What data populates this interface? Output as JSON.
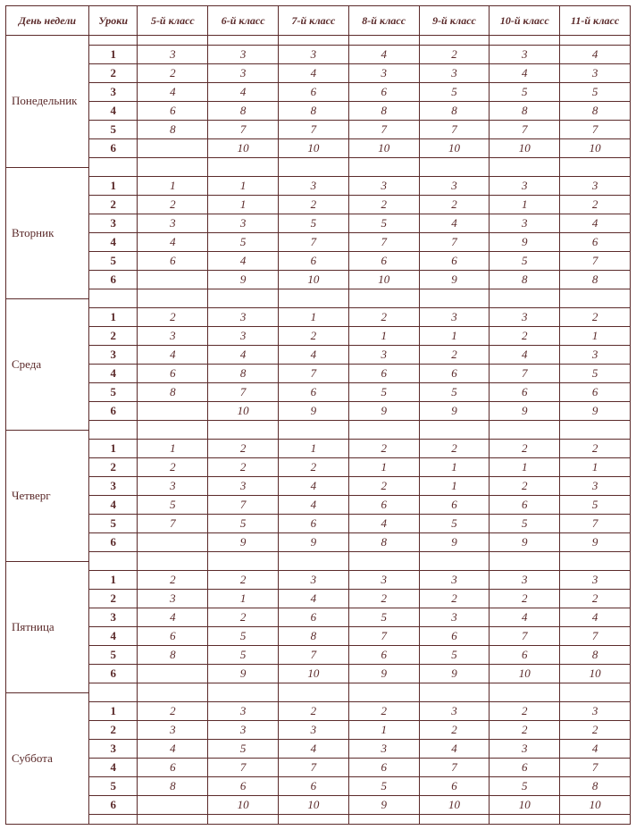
{
  "headers": {
    "day": "День недели",
    "lessons": "Уроки",
    "grades": [
      "5-й класс",
      "6-й класс",
      "7-й класс",
      "8-й класс",
      "9-й класс",
      "10-й класс",
      "11-й класс"
    ]
  },
  "lesson_labels": [
    "1",
    "2",
    "3",
    "4",
    "5",
    "6"
  ],
  "days": [
    {
      "name": "Понедельник",
      "rows": [
        [
          "3",
          "3",
          "3",
          "4",
          "2",
          "3",
          "4"
        ],
        [
          "2",
          "3",
          "4",
          "3",
          "3",
          "4",
          "3"
        ],
        [
          "4",
          "4",
          "6",
          "6",
          "5",
          "5",
          "5"
        ],
        [
          "6",
          "8",
          "8",
          "8",
          "8",
          "8",
          "8"
        ],
        [
          "8",
          "7",
          "7",
          "7",
          "7",
          "7",
          "7"
        ],
        [
          "",
          "10",
          "10",
          "10",
          "10",
          "10",
          "10"
        ]
      ]
    },
    {
      "name": "Вторник",
      "rows": [
        [
          "1",
          "1",
          "3",
          "3",
          "3",
          "3",
          "3"
        ],
        [
          "2",
          "1",
          "2",
          "2",
          "2",
          "1",
          "2"
        ],
        [
          "3",
          "3",
          "5",
          "5",
          "4",
          "3",
          "4"
        ],
        [
          "4",
          "5",
          "7",
          "7",
          "7",
          "9",
          "6"
        ],
        [
          "6",
          "4",
          "6",
          "6",
          "6",
          "5",
          "7"
        ],
        [
          "",
          "9",
          "10",
          "10",
          "9",
          "8",
          "8"
        ]
      ]
    },
    {
      "name": "Среда",
      "rows": [
        [
          "2",
          "3",
          "1",
          "2",
          "3",
          "3",
          "2"
        ],
        [
          "3",
          "3",
          "2",
          "1",
          "1",
          "2",
          "1"
        ],
        [
          "4",
          "4",
          "4",
          "3",
          "2",
          "4",
          "3"
        ],
        [
          "6",
          "8",
          "7",
          "6",
          "6",
          "7",
          "5"
        ],
        [
          "8",
          "7",
          "6",
          "5",
          "5",
          "6",
          "6"
        ],
        [
          "",
          "10",
          "9",
          "9",
          "9",
          "9",
          "9"
        ]
      ]
    },
    {
      "name": "Четверг",
      "rows": [
        [
          "1",
          "2",
          "1",
          "2",
          "2",
          "2",
          "2"
        ],
        [
          "2",
          "2",
          "2",
          "1",
          "1",
          "1",
          "1"
        ],
        [
          "3",
          "3",
          "4",
          "2",
          "1",
          "2",
          "3"
        ],
        [
          "5",
          "7",
          "4",
          "6",
          "6",
          "6",
          "5"
        ],
        [
          "7",
          "5",
          "6",
          "4",
          "5",
          "5",
          "7"
        ],
        [
          "",
          "9",
          "9",
          "8",
          "9",
          "9",
          "9"
        ]
      ]
    },
    {
      "name": "Пятница",
      "rows": [
        [
          "2",
          "2",
          "3",
          "3",
          "3",
          "3",
          "3"
        ],
        [
          "3",
          "1",
          "4",
          "2",
          "2",
          "2",
          "2"
        ],
        [
          "4",
          "2",
          "6",
          "5",
          "3",
          "4",
          "4"
        ],
        [
          "6",
          "5",
          "8",
          "7",
          "6",
          "7",
          "7"
        ],
        [
          "8",
          "5",
          "7",
          "6",
          "5",
          "6",
          "8"
        ],
        [
          "",
          "9",
          "10",
          "9",
          "9",
          "10",
          "10"
        ]
      ]
    },
    {
      "name": "Суббота",
      "rows": [
        [
          "2",
          "3",
          "2",
          "2",
          "3",
          "2",
          "3"
        ],
        [
          "3",
          "3",
          "3",
          "1",
          "2",
          "2",
          "2"
        ],
        [
          "4",
          "5",
          "4",
          "3",
          "4",
          "3",
          "4"
        ],
        [
          "6",
          "7",
          "7",
          "6",
          "7",
          "6",
          "7"
        ],
        [
          "8",
          "6",
          "6",
          "5",
          "6",
          "5",
          "8"
        ],
        [
          "",
          "10",
          "10",
          "9",
          "10",
          "10",
          "10"
        ]
      ]
    }
  ]
}
